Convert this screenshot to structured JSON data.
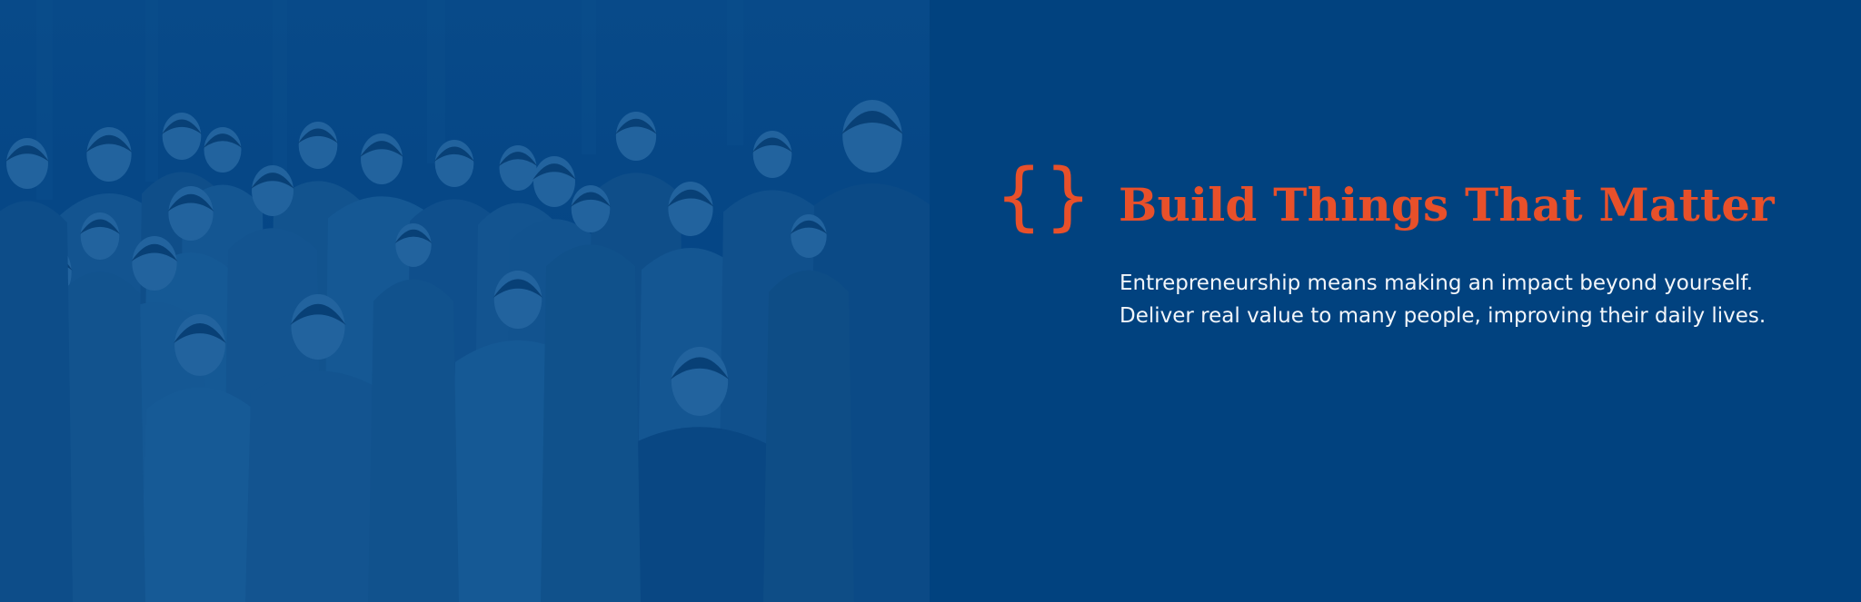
{
  "hero": {
    "braces_glyph": "{}",
    "title": "Build Things That Matter",
    "body_lines": [
      "Entrepreneurship means making an impact beyond yourself.",
      "Deliver real value to many people, improving their daily lives."
    ]
  },
  "photo": {
    "subject": "group-photo",
    "people_count": 25
  },
  "colors": {
    "background": "#01427f",
    "accent": "#e8502a",
    "text": "#f3f6fa",
    "photo_tint": "#0a4a8a"
  }
}
